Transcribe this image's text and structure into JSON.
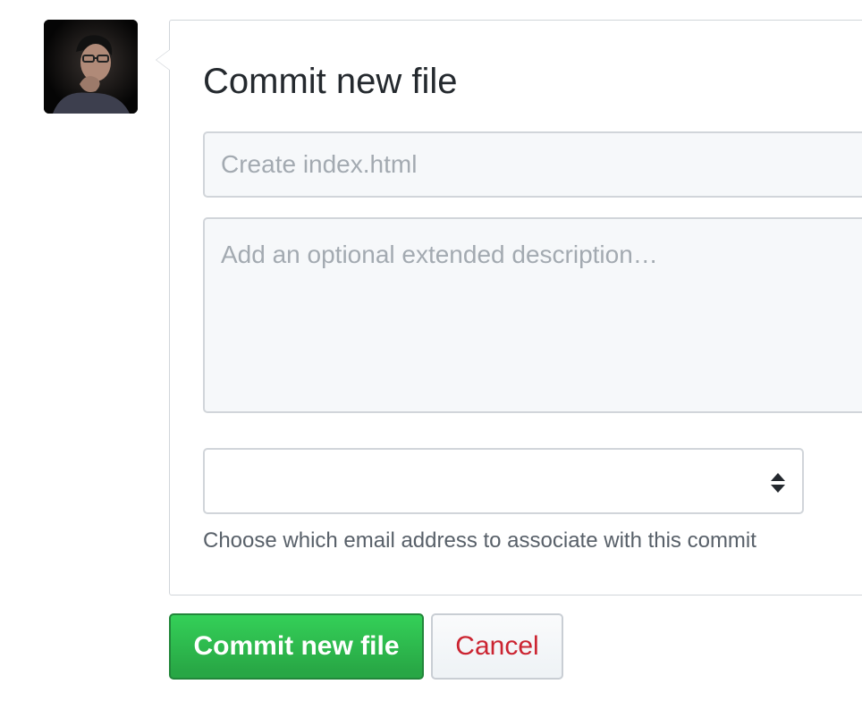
{
  "avatar": {
    "alt": "user avatar"
  },
  "commit_form": {
    "title": "Commit new file",
    "summary_placeholder": "Create index.html",
    "description_placeholder": "Add an optional extended description…",
    "email_select_value": "",
    "email_note": "Choose which email address to associate with this commit"
  },
  "actions": {
    "commit_label": "Commit new file",
    "cancel_label": "Cancel"
  },
  "colors": {
    "commit_green": "#28a745",
    "cancel_red": "#cb2431",
    "input_bg": "#f6f8fa",
    "border": "#d1d5da"
  }
}
